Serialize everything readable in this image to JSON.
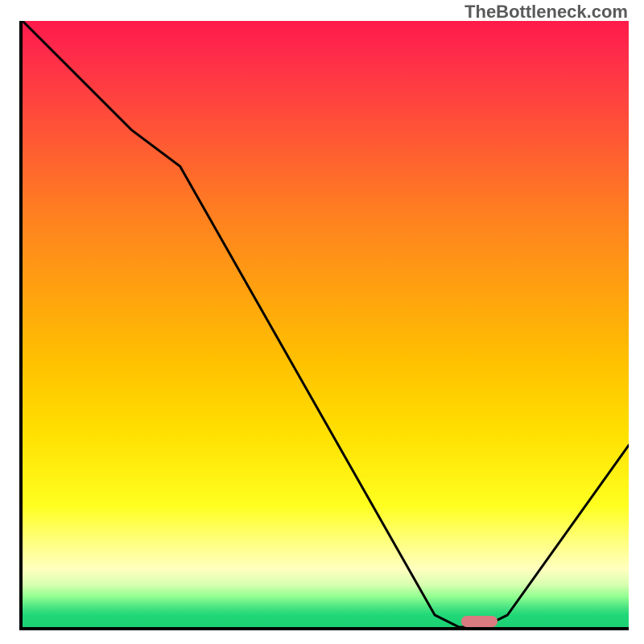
{
  "watermark": "TheBottleneck.com",
  "chart_data": {
    "type": "line",
    "title": "",
    "xlabel": "",
    "ylabel": "",
    "xlim": [
      0,
      100
    ],
    "ylim": [
      0,
      100
    ],
    "x": [
      0,
      18,
      26,
      68,
      72,
      76,
      80,
      100
    ],
    "values": [
      100,
      82,
      76,
      2,
      0,
      0,
      2,
      30
    ],
    "marker": {
      "x_center": 75,
      "y": 1.5,
      "width": 6
    },
    "background_gradient": {
      "orientation": "vertical",
      "stops": [
        {
          "pos": 0,
          "color": "#ff1a4a"
        },
        {
          "pos": 22,
          "color": "#ff6030"
        },
        {
          "pos": 56,
          "color": "#ffc000"
        },
        {
          "pos": 80,
          "color": "#ffff20"
        },
        {
          "pos": 93,
          "color": "#d8ffb0"
        },
        {
          "pos": 100,
          "color": "#1cd074"
        }
      ]
    }
  }
}
